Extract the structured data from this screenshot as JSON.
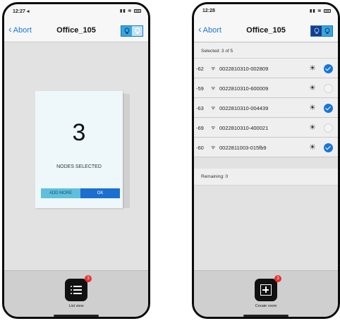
{
  "left_screen": {
    "status": {
      "time": "12:27 ◂"
    },
    "nav": {
      "back_label": "Abort",
      "title": "Office_105"
    },
    "dialog": {
      "count": "3",
      "caption": "NODES SELECTED",
      "add_more_label": "ADD MORE",
      "ok_label": "OK"
    },
    "bottom": {
      "badge": "3",
      "label": "List view",
      "icon": "list-icon"
    }
  },
  "right_screen": {
    "status": {
      "time": "12:28"
    },
    "nav": {
      "back_label": "Abort",
      "title": "Office_105"
    },
    "selected_header": "Selected: 3 of 5",
    "nodes": [
      {
        "rssi": "-62",
        "id": "0022810310-002809",
        "selected": true
      },
      {
        "rssi": "-59",
        "id": "0022810310-600009",
        "selected": false
      },
      {
        "rssi": "-63",
        "id": "0022810310-004439",
        "selected": true
      },
      {
        "rssi": "-69",
        "id": "0022810310-400021",
        "selected": false
      },
      {
        "rssi": "-60",
        "id": "0022811003-015fb9",
        "selected": true
      }
    ],
    "remaining": "Remaining: 0",
    "bottom": {
      "badge": "3",
      "label": "Create room",
      "icon": "plus-square-icon"
    }
  },
  "colors": {
    "accent": "#1877d4",
    "badge": "#e8322f",
    "add_more": "#5fc0dd",
    "ok": "#1b6fd0"
  }
}
